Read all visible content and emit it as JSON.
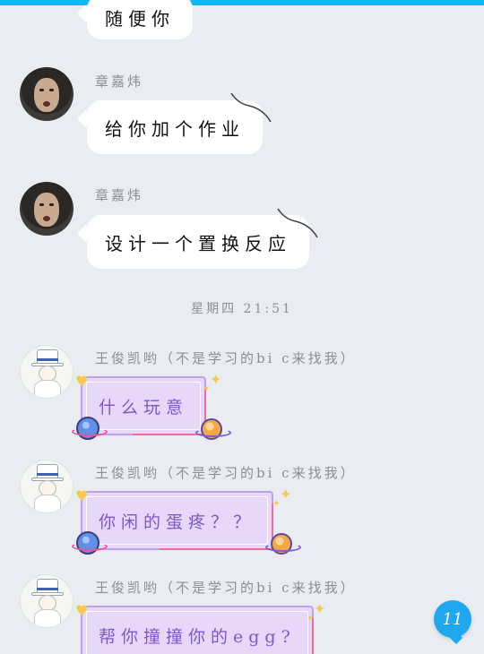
{
  "colors": {
    "background": "#e9edf2",
    "accent": "#12b7f5",
    "bubble_white": "#ffffff",
    "bubble_purple": "#e7d8fa",
    "purple_text": "#7d56c7"
  },
  "messages": [
    {
      "sender": "",
      "text": "随便你",
      "style": "white",
      "avatar": "none"
    },
    {
      "sender": "章嘉炜",
      "text": "给你加个作业",
      "style": "white",
      "avatar": "photo-avatar"
    },
    {
      "sender": "章嘉炜",
      "text": "设计一个置换反应",
      "style": "white",
      "avatar": "photo-avatar"
    },
    {
      "sender": "王俊凯哟（不是学习的bi c来找我）",
      "text": "什么玩意",
      "style": "purple",
      "avatar": "sketch-avatar"
    },
    {
      "sender": "王俊凯哟（不是学习的bi c来找我）",
      "text": "你闲的蛋疼？？",
      "style": "purple",
      "avatar": "sketch-avatar"
    },
    {
      "sender": "王俊凯哟（不是学习的bi c来找我）",
      "text": "帮你撞撞你的egg?",
      "style": "purple",
      "avatar": "sketch-avatar"
    }
  ],
  "timestamp": "星期四  21:51",
  "fab": {
    "label": "11",
    "icon": "chat-bubble-icon"
  }
}
